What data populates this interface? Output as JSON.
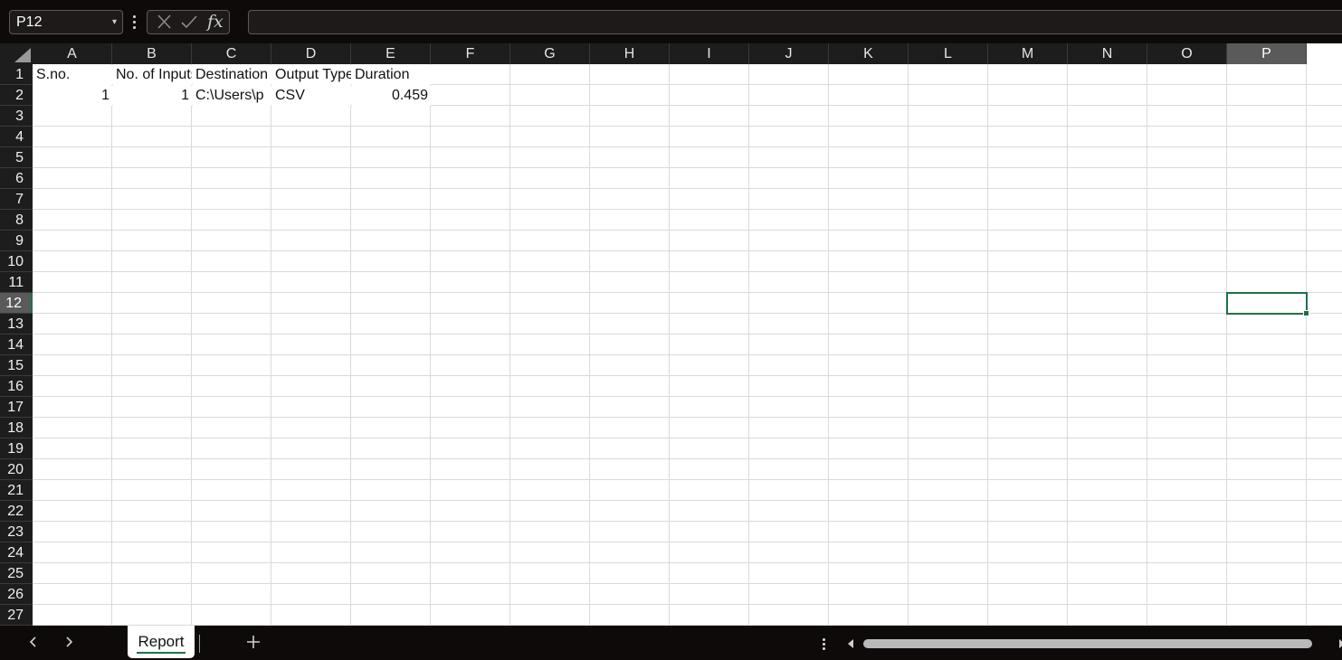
{
  "formula_bar": {
    "name_box": "P12",
    "fx_label": "fx",
    "formula": ""
  },
  "columns": [
    "A",
    "B",
    "C",
    "D",
    "E",
    "F",
    "G",
    "H",
    "I",
    "J",
    "K",
    "L",
    "M",
    "N",
    "O",
    "P"
  ],
  "rows": [
    "1",
    "2",
    "3",
    "4",
    "5",
    "6",
    "7",
    "8",
    "9",
    "10",
    "11",
    "12",
    "13",
    "14",
    "15",
    "16",
    "17",
    "18",
    "19",
    "20",
    "21",
    "22",
    "23",
    "24",
    "25",
    "26",
    "27"
  ],
  "active_cell": {
    "column": "P",
    "row": "12"
  },
  "cells": {
    "A1": "S.no.",
    "B1": "No. of Inputs",
    "C1": "Destination",
    "D1": "Output Type",
    "E1": "Duration",
    "A2": "1",
    "B2": "1",
    "C2": "C:\\Users\\p",
    "D2": "CSV",
    "E2": "0.459"
  },
  "sheet_tabs": [
    {
      "label": "Report",
      "active": true
    }
  ],
  "colors": {
    "accent": "#1e7145",
    "header_bg": "#1d1d1d",
    "active_header_bg": "#5a5a5a",
    "app_bg": "#0f0a0a"
  },
  "icons": {
    "cancel": "x-icon",
    "enter": "checkmark-icon",
    "prev_sheet": "chevron-left-icon",
    "next_sheet": "chevron-right-icon",
    "add_sheet": "plus-icon",
    "options": "vertical-dots-icon"
  }
}
